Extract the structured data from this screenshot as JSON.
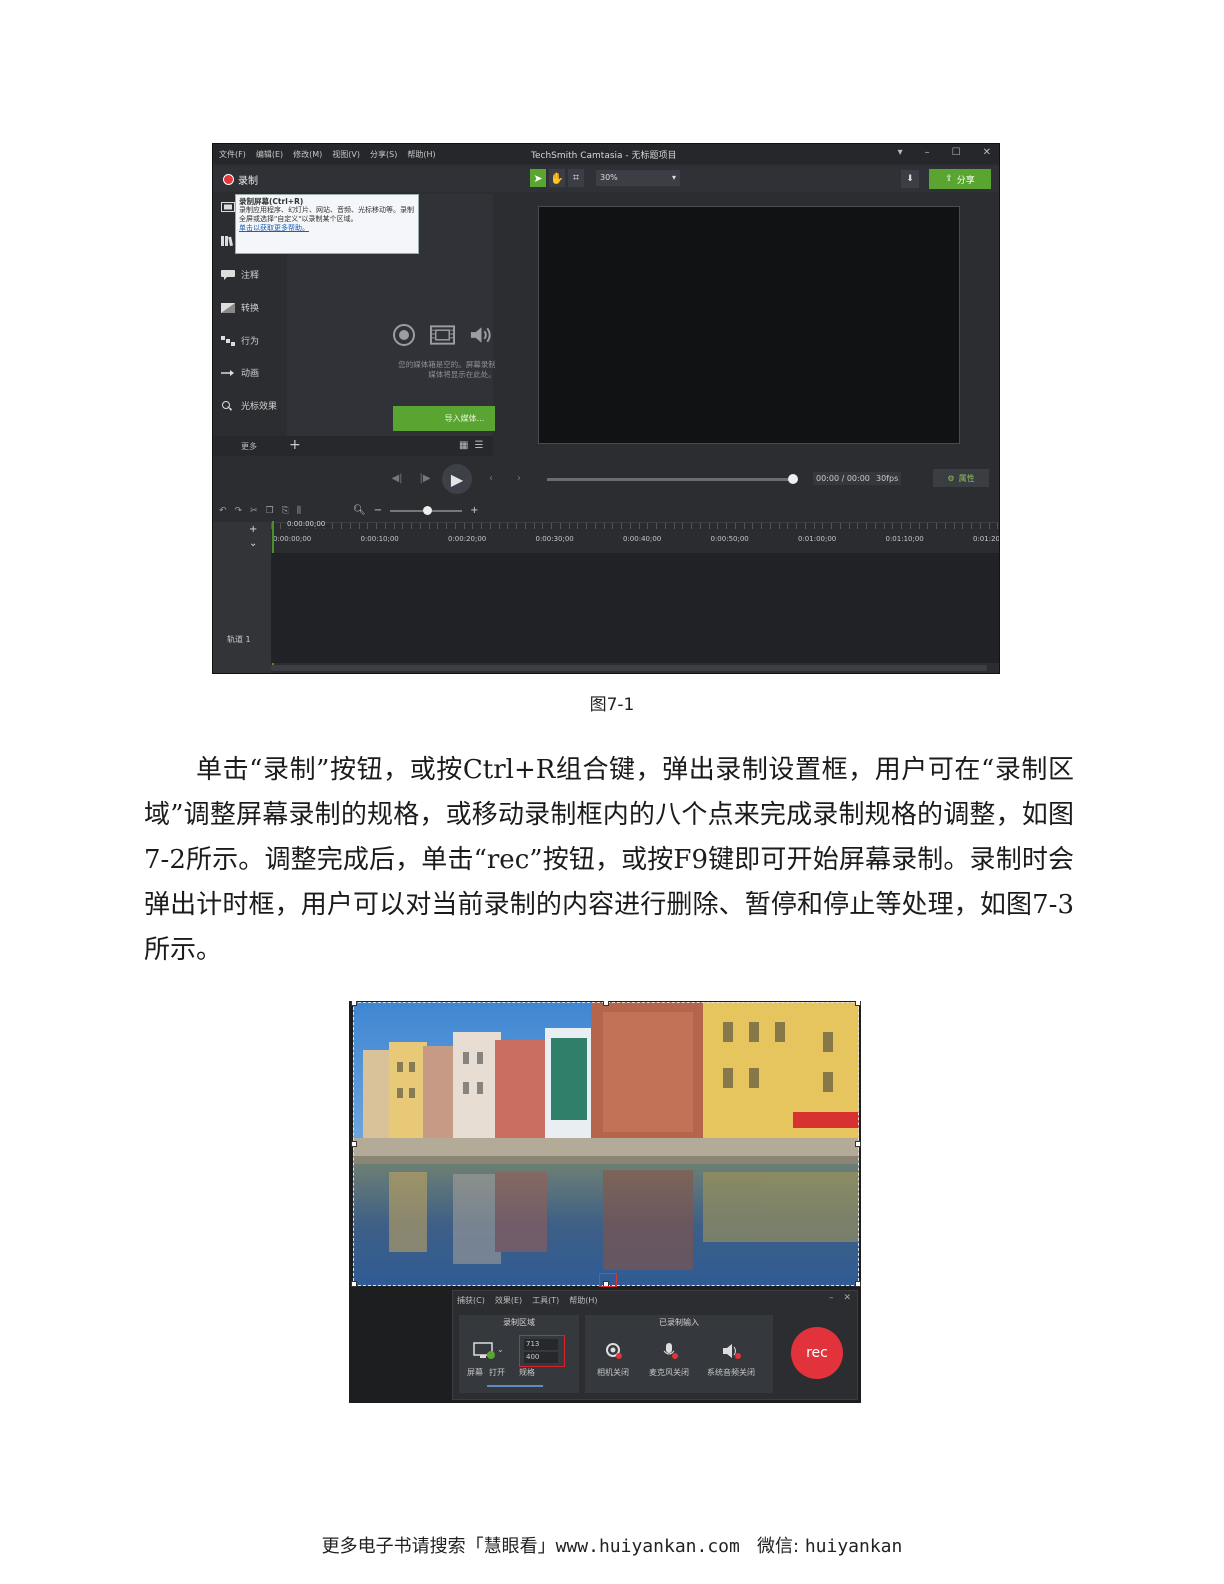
{
  "figure1": {
    "menu": [
      "文件(F)",
      "编辑(E)",
      "修改(M)",
      "视图(V)",
      "分享(S)",
      "帮助(H)"
    ],
    "app_title": "TechSmith Camtasia - 无标题项目",
    "record_label": "录制",
    "zoom": "30%",
    "share_label": "分享",
    "tooltip": {
      "title": "录制屏幕(Ctrl+R)",
      "body": "录制应用程序、幻灯片、网站、音频、光标移动等。录制全屏或选择\"自定义\"以录制某个区域。",
      "link": "单击以获取更多帮助。"
    },
    "sidebar": [
      "注释",
      "转换",
      "行为",
      "动画",
      "光标效果"
    ],
    "empty_media_text": "您的媒体箱是空的。屏幕录制和导入的媒体将显示在此处。",
    "import_label": "导入媒体...",
    "more_label": "更多",
    "timecode": "00:00 / 00:00",
    "fps": "30fps",
    "properties_label": "属性",
    "playhead_time": "0:00:00;00",
    "ruler": [
      "0:00:00;00",
      "0:00:10;00",
      "0:00:20;00",
      "0:00:30;00",
      "0:00:40;00",
      "0:00:50;00",
      "0:01:00;00",
      "0:01:10;00",
      "0:01:20;"
    ],
    "track_label": "轨道 1"
  },
  "caption1": "图7-1",
  "paragraph": "单击“录制”按钮，或按Ctrl+R组合键，弹出录制设置框，用户可在“录制区域”调整屏幕录制的规格，或移动录制框内的八个点来完成录制规格的调整，如图7-2所示。调整完成后，单击“rec”按钮，或按F9键即可开始屏幕录制。录制时会弹出计时框，用户可以对当前录制的内容进行删除、暂停和停止等处理，如图7-3所示。",
  "figure2": {
    "menu": [
      "捕获(C)",
      "效果(E)",
      "工具(T)",
      "帮助(H)"
    ],
    "region_title": "录制区域",
    "inputs_title": "已录制输入",
    "screen_label": "屏幕",
    "open_label": "打开",
    "size_label": "规格",
    "width": "713",
    "height": "400",
    "camera_label": "相机关闭",
    "mic_label": "麦克风关闭",
    "audio_label": "系统音频关闭",
    "rec_label": "rec"
  },
  "footer": {
    "prefix": "更多电子书请搜索「慧眼看」",
    "url": "www.huiyankan.com",
    "wechat_label": "微信:",
    "wechat_id": "huiyankan"
  },
  "colors": {
    "accent_green": "#5aa532",
    "record_red": "#e2323b",
    "dark_bg": "#2b2d31"
  }
}
